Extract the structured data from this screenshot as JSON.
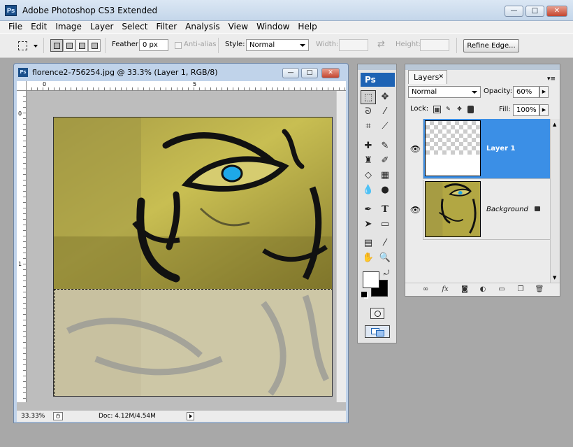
{
  "app": {
    "title": "Adobe Photoshop CS3 Extended",
    "logo": "Ps",
    "controls": {
      "minimize": "—",
      "maximize": "□",
      "close": "✕"
    }
  },
  "menu": [
    "File",
    "Edit",
    "Image",
    "Layer",
    "Select",
    "Filter",
    "Analysis",
    "View",
    "Window",
    "Help"
  ],
  "options_bar": {
    "feather_label": "Feather:",
    "feather_value": "0 px",
    "antialias_label": "Anti-alias",
    "style_label": "Style:",
    "style_value": "Normal",
    "width_label": "Width:",
    "height_label": "Height:",
    "refine_edge": "Refine Edge..."
  },
  "document": {
    "title": "florence2-756254.jpg @ 33.3% (Layer 1, RGB/8)",
    "icon": "Ps",
    "ruler_top_labels": [
      "0",
      "5"
    ],
    "ruler_left_labels": [
      "0",
      "1"
    ],
    "zoom": "33.33%",
    "doc_info": "Doc: 4.12M/4.54M"
  },
  "tools": {
    "logo": "Ps"
  },
  "layers_panel": {
    "tab": "Layers",
    "blend_mode": "Normal",
    "opacity_label": "Opacity:",
    "opacity_value": "60%",
    "lock_label": "Lock:",
    "fill_label": "Fill:",
    "fill_value": "100%",
    "layers": [
      {
        "name": "Layer 1",
        "selected": true,
        "visible": true
      },
      {
        "name": "Background",
        "selected": false,
        "visible": true
      }
    ]
  },
  "colors": {
    "selected_layer": "#3b8fe6",
    "eye_iris": "#1ea8e8",
    "wall_yellow": "#b9ad3c"
  }
}
